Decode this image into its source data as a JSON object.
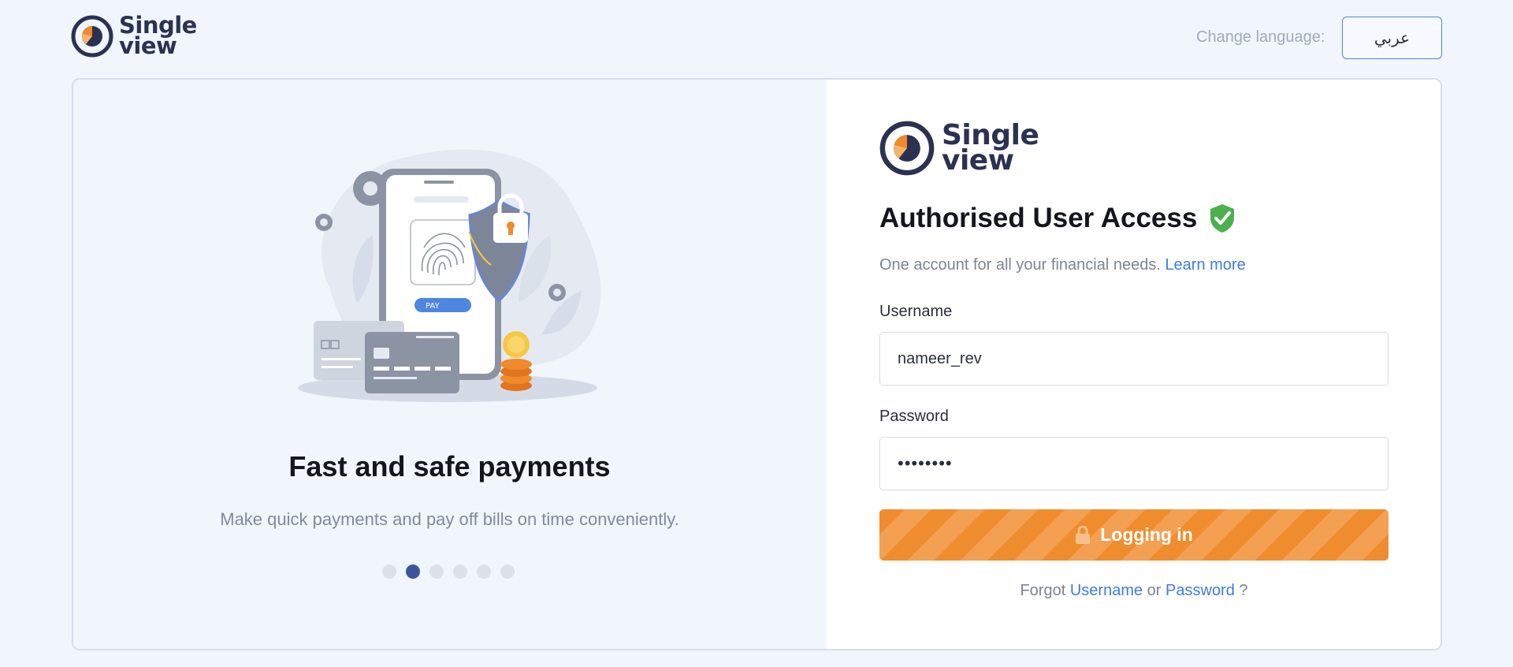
{
  "header": {
    "logo_line1": "Single",
    "logo_line2": "view",
    "change_language_label": "Change language:",
    "language_button": "عربي"
  },
  "carousel": {
    "slide_title": "Fast and safe payments",
    "slide_text": "Make quick payments and pay off bills on time conveniently.",
    "pay_label": "PAY",
    "active_index": 1,
    "dot_count": 6
  },
  "login": {
    "logo_line1": "Single",
    "logo_line2": "view",
    "title": "Authorised User Access",
    "subline_text": "One account for all your financial needs.",
    "learn_more": "Learn more",
    "username_label": "Username",
    "username_value": "nameer_rev",
    "password_label": "Password",
    "password_value": "••••••••",
    "submit_label": "Logging in",
    "forgot_prefix": "Forgot",
    "forgot_username": "Username",
    "forgot_or": "or",
    "forgot_password": "Password",
    "forgot_suffix": "?"
  },
  "icons": {
    "shield_check": "shield-check-icon",
    "lock": "lock-icon",
    "logo": "singleview-logo-icon"
  },
  "colors": {
    "accent_orange": "#ef8d2e",
    "link_blue": "#3d7ce0",
    "brand_navy": "#2b3251",
    "verified_green": "#4caf50"
  }
}
